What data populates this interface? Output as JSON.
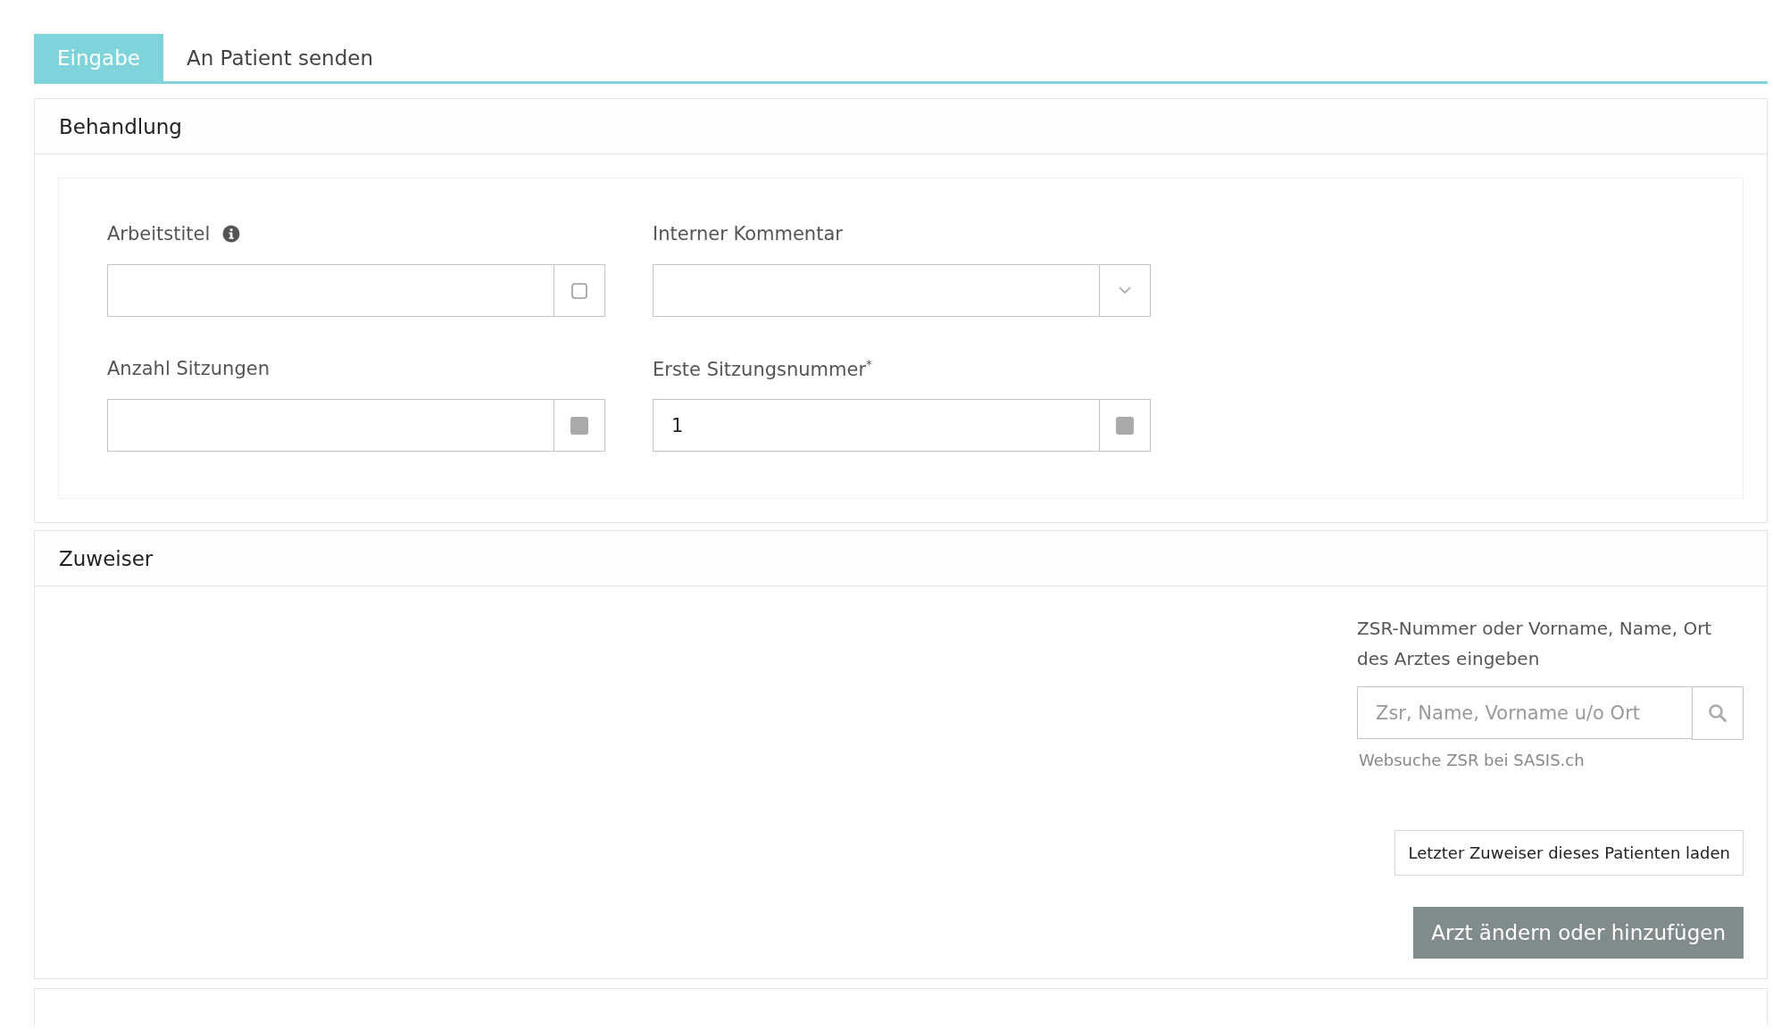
{
  "tabs": [
    {
      "label": "Eingabe",
      "selected": true
    },
    {
      "label": "An Patient senden",
      "selected": false
    }
  ],
  "behandlung": {
    "title": "Behandlung",
    "fields": [
      {
        "label": "Arbeitstitel",
        "info": true,
        "kind": "empty-square"
      },
      {
        "label": "Interner Kommentar",
        "info": false,
        "kind": "chevron"
      },
      {
        "label": "Anzahl Sitzungen",
        "info": false,
        "kind": "filled-square"
      },
      {
        "label": "Erste Sitzungsnummer",
        "required_mark": "*",
        "info": false,
        "value": "1",
        "kind": "filled-square"
      }
    ]
  },
  "zuweiser": {
    "title": "Zuweiser",
    "search_label": "ZSR-Nummer oder Vorname, Name, Ort des Arztes eingeben",
    "search_placeholder": "Zsr, Name, Vorname u/o Ort",
    "link": "Websuche ZSR bei SASIS.ch",
    "buttons": [
      {
        "label": "Letzter Zuweiser dieses Patienten laden",
        "kind": "secondary"
      },
      {
        "label": "Arzt ändern oder hinzufügen",
        "kind": "primary"
      }
    ]
  }
}
